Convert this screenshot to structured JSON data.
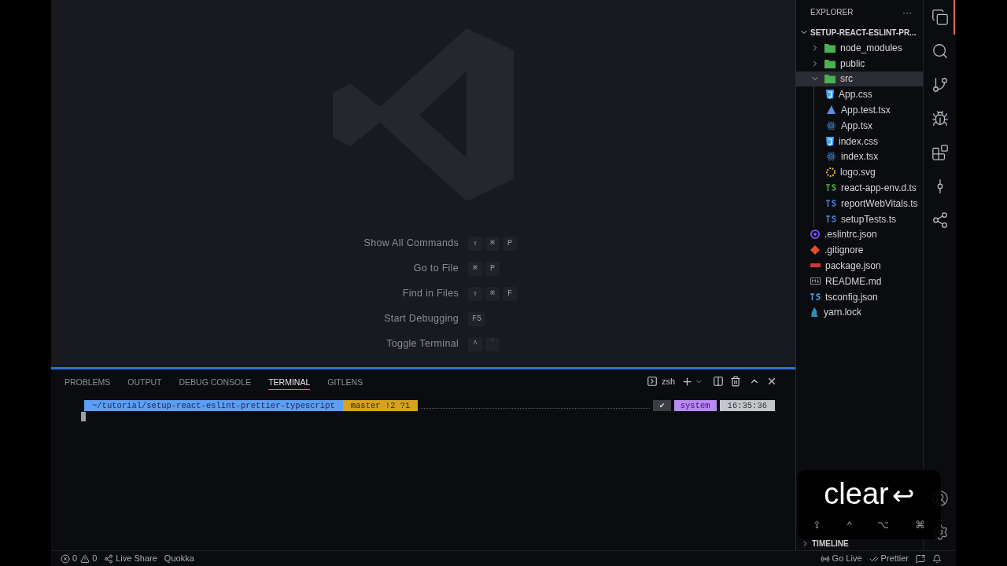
{
  "editor": {
    "shortcuts": [
      {
        "label": "Show All Commands",
        "keys": [
          "⇧",
          "⌘",
          "P"
        ]
      },
      {
        "label": "Go to File",
        "keys": [
          "⌘",
          "P"
        ]
      },
      {
        "label": "Find in Files",
        "keys": [
          "⇧",
          "⌘",
          "F"
        ]
      },
      {
        "label": "Start Debugging",
        "keys": [
          "F5"
        ]
      },
      {
        "label": "Toggle Terminal",
        "keys": [
          "^",
          "`"
        ]
      }
    ]
  },
  "panel": {
    "tabs": [
      {
        "label": "PROBLEMS",
        "selected": false
      },
      {
        "label": "OUTPUT",
        "selected": false
      },
      {
        "label": "DEBUG CONSOLE",
        "selected": false
      },
      {
        "label": "TERMINAL",
        "selected": true
      },
      {
        "label": "GITLENS",
        "selected": false
      }
    ],
    "shell": "zsh",
    "prompt": {
      "path": "~/tutorial/setup-react-eslint-prettier-typescript",
      "git": "master !2 ?1",
      "status": "✔",
      "context": "system",
      "time": "16:35:36"
    }
  },
  "explorer": {
    "title": "EXPLORER",
    "more": "···",
    "root": {
      "label": "SETUP-REACT-ESLINT-PR...",
      "expanded": true
    },
    "items": [
      {
        "label": "node_modules",
        "kind": "folder",
        "expanded": false,
        "selected": false
      },
      {
        "label": "public",
        "kind": "folder",
        "expanded": false,
        "selected": false
      },
      {
        "label": "src",
        "kind": "folder",
        "expanded": true,
        "selected": true,
        "children": [
          {
            "label": "App.css",
            "kind": "css",
            "selected": false
          },
          {
            "label": "App.test.tsx",
            "kind": "test",
            "selected": false
          },
          {
            "label": "App.tsx",
            "kind": "react",
            "selected": false
          },
          {
            "label": "index.css",
            "kind": "css",
            "selected": false
          },
          {
            "label": "index.tsx",
            "kind": "react",
            "selected": false
          },
          {
            "label": "logo.svg",
            "kind": "svg",
            "selected": false
          },
          {
            "label": "react-app-env.d.ts",
            "kind": "ts-green",
            "selected": false
          },
          {
            "label": "reportWebVitals.ts",
            "kind": "ts",
            "selected": false
          },
          {
            "label": "setupTests.ts",
            "kind": "ts",
            "selected": false
          }
        ]
      },
      {
        "label": ".eslintrc.json",
        "kind": "eslint",
        "selected": false
      },
      {
        "label": ".gitignore",
        "kind": "git",
        "selected": false
      },
      {
        "label": "package.json",
        "kind": "npm",
        "selected": false
      },
      {
        "label": "README.md",
        "kind": "md",
        "selected": false
      },
      {
        "label": "tsconfig.json",
        "kind": "tsconfig",
        "selected": false
      },
      {
        "label": "yarn.lock",
        "kind": "yarn",
        "selected": false
      }
    ],
    "timeline": {
      "label": "TIMELINE",
      "expanded": false
    }
  },
  "keystroke_overlay": {
    "text": "clear",
    "enter": "↩",
    "modifiers": [
      "⇧",
      "^",
      "⌥",
      "⌘"
    ]
  },
  "status_bar": {
    "errors": "0",
    "warnings": "0",
    "left": [
      "Live Share",
      "Quokka"
    ],
    "right": [
      "Go Live",
      "Prettier"
    ]
  }
}
